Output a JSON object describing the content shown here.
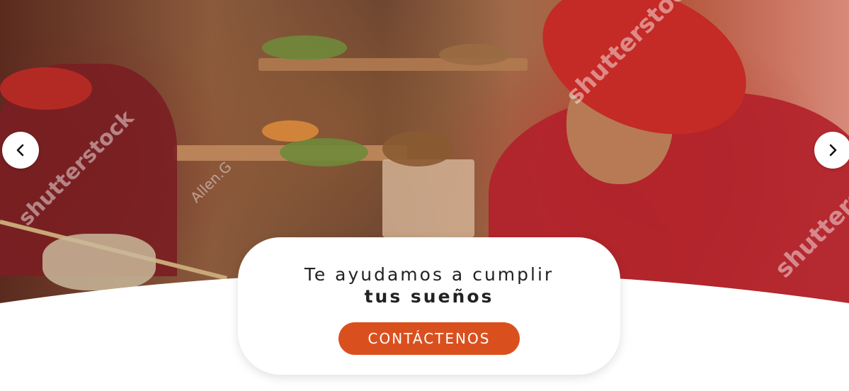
{
  "hero": {
    "watermarks": [
      "shutterstock",
      "shutterstock",
      "shutterstock",
      "Allen.G"
    ]
  },
  "carousel": {
    "prev_icon": "chevron-left-icon",
    "next_icon": "chevron-right-icon"
  },
  "card": {
    "line1": "Te ayudamos a cumplir",
    "line2": "tus sueños",
    "cta_label": "CONTÁCTENOS"
  },
  "colors": {
    "accent": "#d9501e",
    "text": "#222222",
    "background": "#ffffff"
  }
}
